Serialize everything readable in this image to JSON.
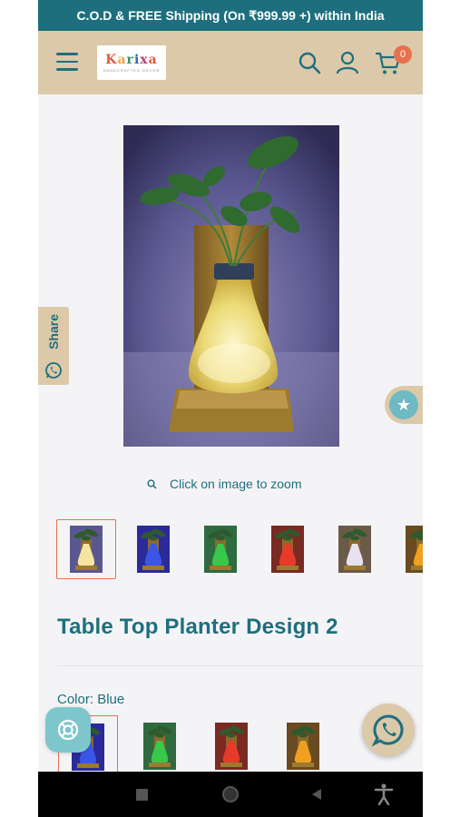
{
  "announcement": {
    "text": "C.O.D & FREE Shipping (On ₹999.99 +) within India"
  },
  "header": {
    "logo_text": "Karixa",
    "logo_tagline": "HANDCRAFTED DECOR",
    "menu_icon": "menu-icon",
    "search_icon": "search-icon",
    "account_icon": "user-icon",
    "cart_icon": "cart-icon",
    "cart_count": "0"
  },
  "gallery": {
    "zoom_hint": "Click on image to zoom",
    "thumbnails": [
      {
        "color": "warm-white",
        "selected": true
      },
      {
        "color": "blue",
        "selected": false
      },
      {
        "color": "green",
        "selected": false
      },
      {
        "color": "red",
        "selected": false
      },
      {
        "color": "white",
        "selected": false
      },
      {
        "color": "amber",
        "selected": false
      }
    ]
  },
  "product": {
    "title": "Table Top Planter Design 2",
    "color_label": "Color:",
    "color_value": "Blue",
    "swatches": [
      {
        "color": "blue",
        "selected": true
      },
      {
        "color": "green",
        "selected": false
      },
      {
        "color": "red",
        "selected": false
      },
      {
        "color": "amber",
        "selected": false
      }
    ]
  },
  "share": {
    "label": "Share"
  },
  "floating": {
    "reviews_icon": "star-icon",
    "help_icon": "lifebuoy-icon",
    "whatsapp_icon": "whatsapp-icon"
  },
  "colors": {
    "primary": "#1e6f7e",
    "beige": "#dcc9a9",
    "accent": "#e8704f",
    "teal_light": "#7ec6cc"
  }
}
